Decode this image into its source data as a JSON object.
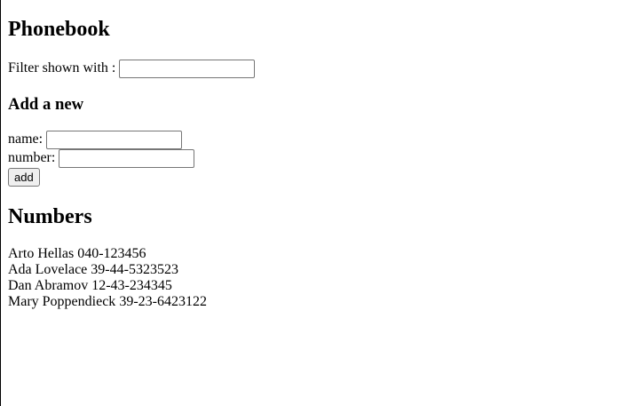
{
  "title": "Phonebook",
  "filter": {
    "label": "Filter shown with :",
    "value": ""
  },
  "add_section": {
    "heading": "Add a new",
    "name_label": "name:",
    "name_value": "",
    "number_label": "number:",
    "number_value": "",
    "button_label": "add"
  },
  "numbers": {
    "heading": "Numbers",
    "entries": [
      {
        "name": "Arto Hellas",
        "number": "040-123456"
      },
      {
        "name": "Ada Lovelace",
        "number": "39-44-5323523"
      },
      {
        "name": "Dan Abramov",
        "number": "12-43-234345"
      },
      {
        "name": "Mary Poppendieck",
        "number": "39-23-6423122"
      }
    ]
  }
}
